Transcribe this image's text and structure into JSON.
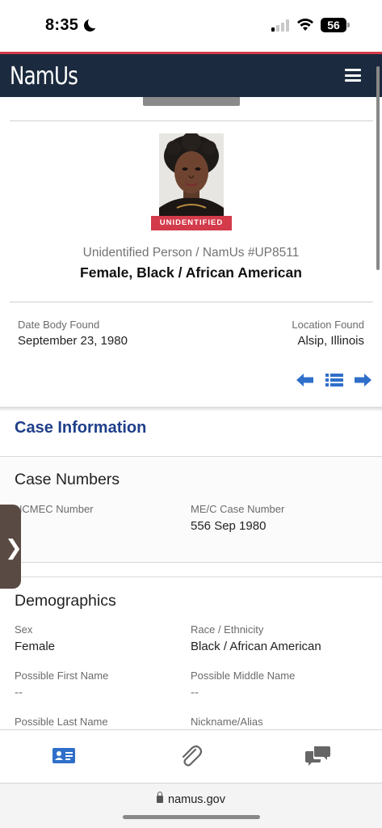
{
  "status_bar": {
    "time": "8:35",
    "battery": "56"
  },
  "header": {
    "logo": "NamUs",
    "menu_icon": "hamburger-menu-icon"
  },
  "profile": {
    "badge": "UNIDENTIFIED",
    "case_id": "Unidentified Person / NamUs #UP8511",
    "summary": "Female, Black / African American",
    "date_body_found_label": "Date Body Found",
    "date_body_found": "September 23, 1980",
    "location_found_label": "Location Found",
    "location_found": "Alsip, Illinois"
  },
  "pager": {
    "prev_icon": "arrow-left-icon",
    "list_icon": "list-icon",
    "next_icon": "arrow-right-icon"
  },
  "case_information": {
    "title": "Case Information"
  },
  "case_numbers": {
    "title": "Case Numbers",
    "ncmec_label": "NCMEC Number",
    "mec_label": "ME/C Case Number",
    "mec_value": "556 Sep 1980"
  },
  "demographics": {
    "title": "Demographics",
    "sex_label": "Sex",
    "sex_value": "Female",
    "race_label": "Race / Ethnicity",
    "race_value": "Black / African American",
    "first_name_label": "Possible First Name",
    "first_name_value": "--",
    "middle_name_label": "Possible Middle Name",
    "middle_name_value": "--",
    "last_name_label": "Possible Last Name",
    "alias_label": "Nickname/Alias"
  },
  "drawer": {
    "icon": "chevron-right-icon",
    "glyph": "❯"
  },
  "tab_bar": {
    "tabs": [
      "id-card-icon",
      "paperclip-icon",
      "chat-bubbles-icon"
    ],
    "active_color": "#2f6fca",
    "inactive_color": "#666666"
  },
  "browser": {
    "url": "namus.gov"
  },
  "colors": {
    "header_bg": "#1b2a3e",
    "accent_red": "#d33a4a",
    "link_blue": "#1f3f8a"
  }
}
